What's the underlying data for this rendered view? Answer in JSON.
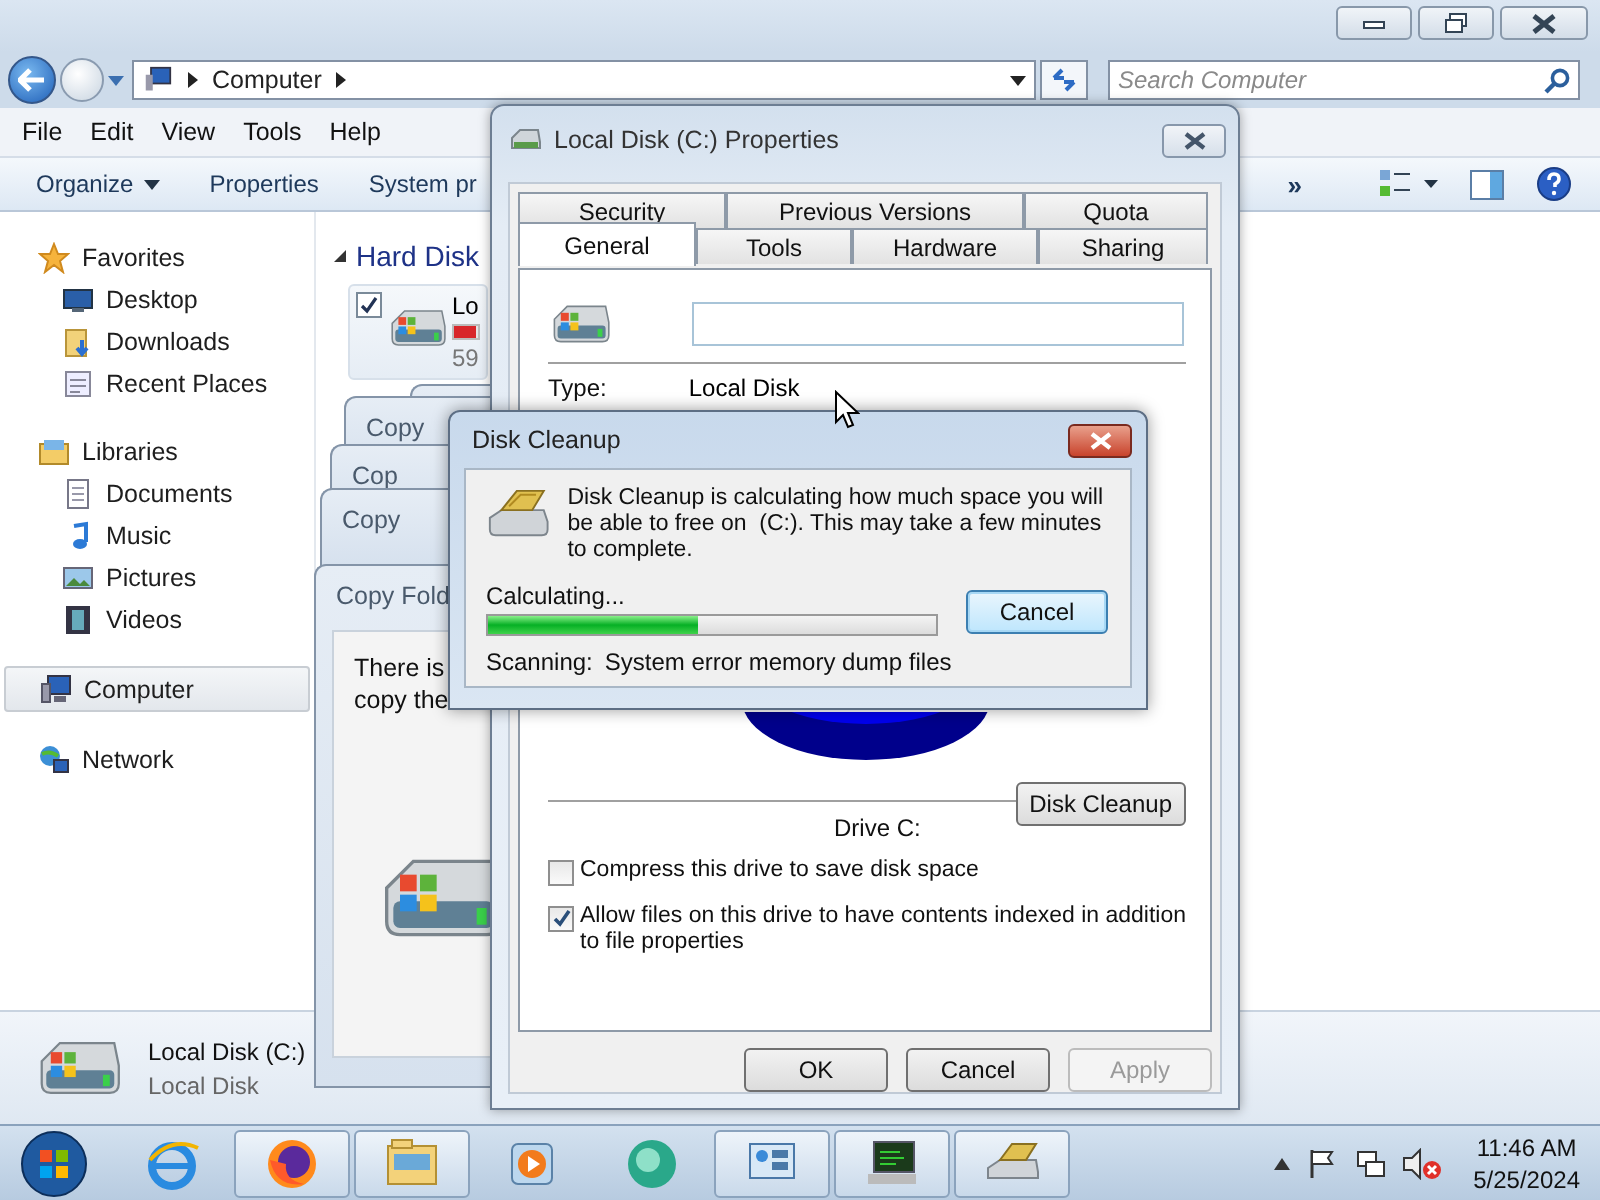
{
  "explorer": {
    "breadcrumb": [
      "Computer"
    ],
    "search_placeholder": "Search Computer",
    "menu": [
      "File",
      "Edit",
      "View",
      "Tools",
      "Help"
    ],
    "toolbar": [
      {
        "label": "Organize",
        "kind": "dropdown"
      },
      {
        "label": "Properties",
        "kind": "button"
      },
      {
        "label": "System pr",
        "kind": "button"
      }
    ],
    "toolbar_overflow": "»",
    "nav": [
      {
        "label": "Favorites",
        "kind": "star",
        "selected": false,
        "children": [
          {
            "label": "Desktop",
            "kind": "desktop",
            "selected": false
          },
          {
            "label": "Downloads",
            "kind": "downloads",
            "selected": false
          },
          {
            "label": "Recent Places",
            "kind": "recent",
            "selected": false
          }
        ]
      },
      {
        "label": "Libraries",
        "kind": "libraries",
        "selected": false,
        "children": [
          {
            "label": "Documents",
            "kind": "documents",
            "selected": false
          },
          {
            "label": "Music",
            "kind": "music",
            "selected": false
          },
          {
            "label": "Pictures",
            "kind": "pictures",
            "selected": false
          },
          {
            "label": "Videos",
            "kind": "videos",
            "selected": false
          }
        ]
      },
      {
        "label": "Computer",
        "kind": "computer",
        "selected": true
      },
      {
        "label": "Network",
        "kind": "network",
        "selected": false
      }
    ],
    "group_header": "Hard Disk",
    "drives": [
      {
        "name": "Lo",
        "size": "59",
        "checked": true,
        "level": 0.9
      }
    ],
    "details": {
      "name": "Local Disk (C:)",
      "type": "Local Disk"
    }
  },
  "copy_dialogs": [
    {
      "title": "Copy"
    },
    {
      "title": "Cop"
    },
    {
      "title": "Copy"
    },
    {
      "title": "Copy Fold",
      "lines": [
        "There is",
        "copy the"
      ]
    }
  ],
  "properties": {
    "title": "Local Disk (C:) Properties",
    "tab_rows": [
      [
        {
          "label": "Security",
          "selected": false
        },
        {
          "label": "Previous Versions",
          "selected": false
        },
        {
          "label": "Quota",
          "selected": false
        }
      ],
      [
        {
          "label": "General",
          "selected": true
        },
        {
          "label": "Tools",
          "selected": false
        },
        {
          "label": "Hardware",
          "selected": false
        },
        {
          "label": "Sharing",
          "selected": false
        }
      ]
    ],
    "type_label": "Type:",
    "type_value": "Local Disk",
    "drive_label": "Drive C:",
    "cleanup_button": "Disk Cleanup",
    "options": [
      {
        "label": "Compress this drive to save disk space",
        "checked": false
      },
      {
        "label": "Allow files on this drive to have contents indexed in addition to file properties",
        "checked": true
      }
    ],
    "buttons": [
      {
        "label": "OK",
        "disabled": false
      },
      {
        "label": "Cancel",
        "disabled": false
      },
      {
        "label": "Apply",
        "disabled": true
      }
    ]
  },
  "disk_cleanup": {
    "title": "Disk Cleanup",
    "message": "Disk Cleanup is calculating how much space you will be able to free on  (C:). This may take a few minutes to complete.",
    "status": "Calculating...",
    "level": 0.47,
    "button": "Cancel",
    "scanning_label": "Scanning:",
    "scanning_item": "System error memory dump files"
  },
  "taskbar": {
    "apps": [
      {
        "kind": "ie",
        "open": false
      },
      {
        "kind": "firefox",
        "open": true
      },
      {
        "kind": "explorer",
        "open": true
      },
      {
        "kind": "media",
        "open": false
      },
      {
        "kind": "circle",
        "open": false
      },
      {
        "kind": "control",
        "open": true
      },
      {
        "kind": "monitor",
        "open": true
      },
      {
        "kind": "cleanup",
        "open": true
      }
    ],
    "time": "11:46 AM",
    "date": "5/25/2024"
  }
}
